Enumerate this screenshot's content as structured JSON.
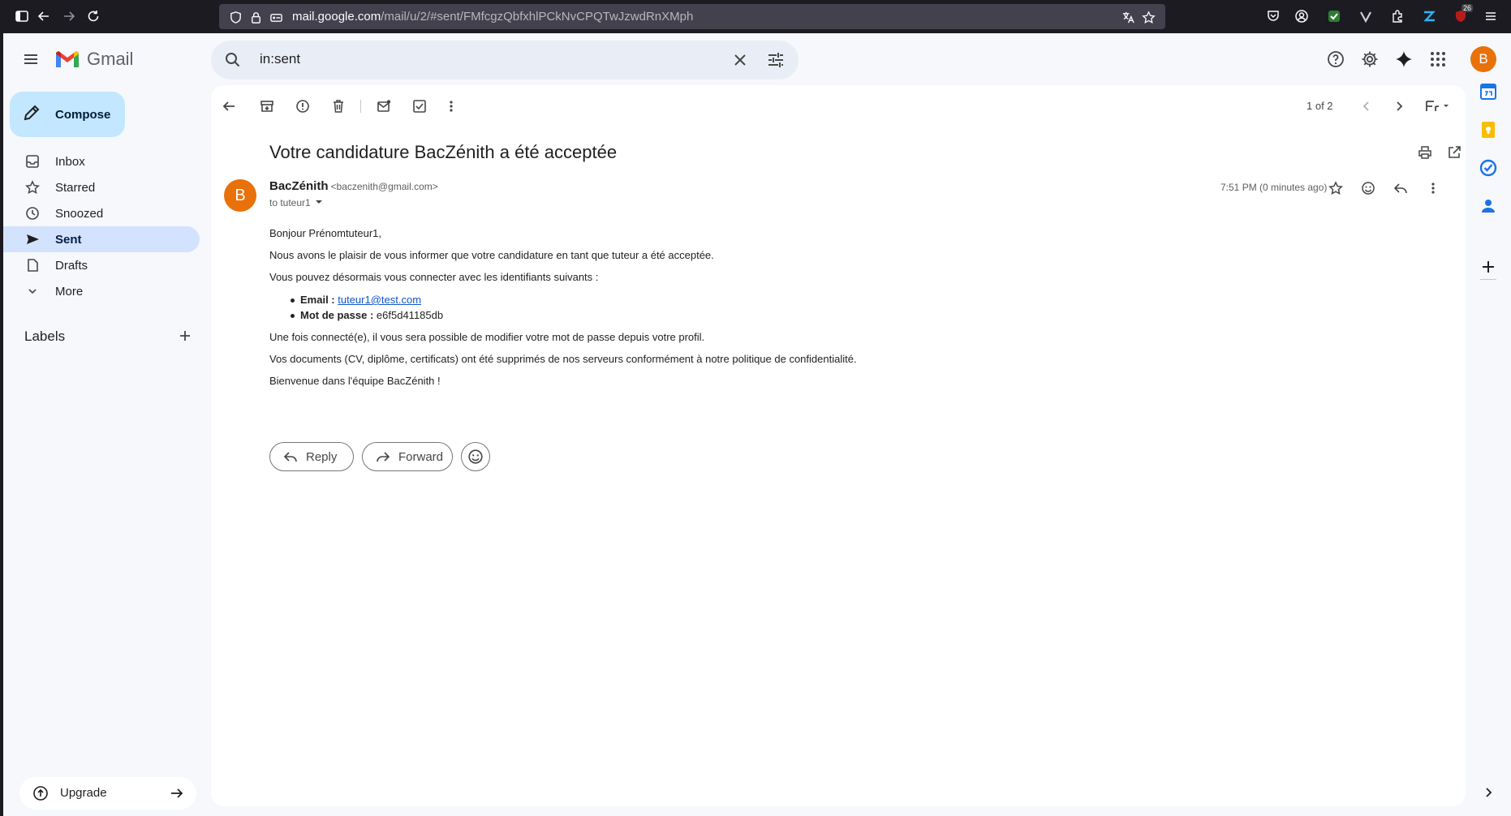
{
  "browser": {
    "url_host": "mail.google.com",
    "url_path": "/mail/u/2/#sent/FMfcgzQbfxhlPCkNvCPQTwJzwdRnXMph",
    "badge_count": "26"
  },
  "header": {
    "brand": "Gmail",
    "search_value": "in:sent",
    "avatar_letter": "B"
  },
  "sidebar": {
    "compose_label": "Compose",
    "items": [
      {
        "label": "Inbox",
        "icon": "inbox-icon"
      },
      {
        "label": "Starred",
        "icon": "star-icon"
      },
      {
        "label": "Snoozed",
        "icon": "clock-icon"
      },
      {
        "label": "Sent",
        "icon": "send-icon",
        "active": true
      },
      {
        "label": "Drafts",
        "icon": "draft-icon"
      },
      {
        "label": "More",
        "icon": "chevron-down-icon"
      }
    ],
    "labels_title": "Labels",
    "upgrade_label": "Upgrade"
  },
  "toolbar": {
    "pager": "1 of 2"
  },
  "message": {
    "subject": "Votre candidature BacZénith a été acceptée",
    "sender_name": "BacZénith",
    "sender_email": "<baczenith@gmail.com>",
    "recipient": "to tuteur1",
    "avatar_letter": "B",
    "time": "7:51 PM (0 minutes ago)",
    "greeting": "Bonjour Prénomtuteur1,",
    "para1": "Nous avons le plaisir de vous informer que votre candidature en tant que tuteur a été acceptée.",
    "para2": "Vous pouvez désormais vous connecter avec les identifiants suivants :",
    "credentials": {
      "email_label": "Email :",
      "email_value": "tuteur1@test.com",
      "password_label": "Mot de passe :",
      "password_value": "e6f5d41185db"
    },
    "para3": "Une fois connecté(e), il vous sera possible de modifier votre mot de passe depuis votre profil.",
    "para4": "Vos documents (CV, diplôme, certificats) ont été supprimés de nos serveurs conformément à notre politique de confidentialité.",
    "closing": "Bienvenue dans l'équipe BacZénith !"
  },
  "actions": {
    "reply_label": "Reply",
    "forward_label": "Forward"
  },
  "colors": {
    "accent_compose": "#c2e7ff",
    "active_nav": "#d3e3fd",
    "avatar": "#e8710a",
    "link": "#1155cc"
  }
}
